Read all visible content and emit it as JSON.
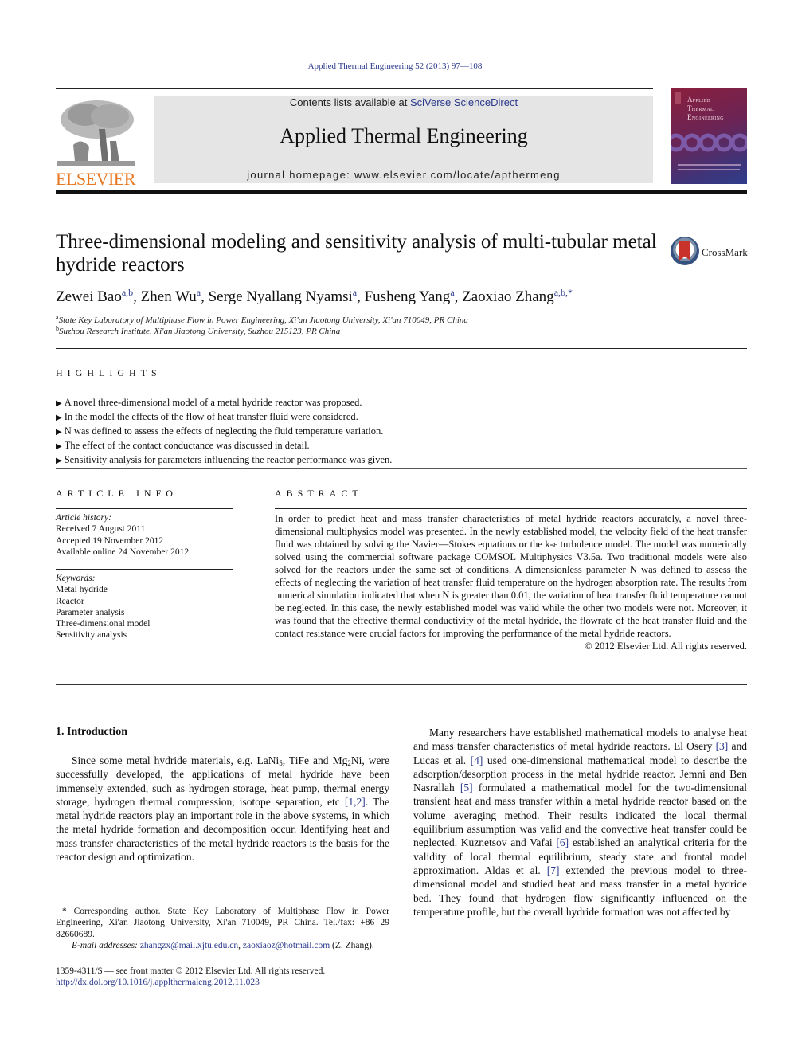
{
  "header": {
    "journal_reference": "Applied Thermal Engineering 52 (2013) 97—108",
    "publisher_logo_text": "ELSEVIER",
    "contents_prefix": "Contents lists available at ",
    "contents_link": "SciVerse ScienceDirect",
    "journal_title": "Applied Thermal Engineering",
    "homepage_prefix": "journal homepage: ",
    "homepage_url": "www.elsevier.com/locate/apthermeng",
    "cover_title_lines": [
      "Applied",
      "Thermal",
      "Engineering"
    ],
    "brand_color": "#e87722",
    "link_color": "#2b3a8c"
  },
  "article": {
    "title": "Three-dimensional modeling and sensitivity analysis of multi-tubular metal hydride reactors",
    "crossmark_label": "CrossMark",
    "authors": [
      {
        "name": "Zewei Bao",
        "affil": "a,b"
      },
      {
        "name": "Zhen Wu",
        "affil": "a"
      },
      {
        "name": "Serge Nyallang Nyamsi",
        "affil": "a"
      },
      {
        "name": "Fusheng Yang",
        "affil": "a"
      },
      {
        "name": "Zaoxiao Zhang",
        "affil": "a,b,*"
      }
    ],
    "affiliations": [
      {
        "mark": "a",
        "text": "State Key Laboratory of Multiphase Flow in Power Engineering, Xi'an Jiaotong University, Xi'an 710049, PR China"
      },
      {
        "mark": "b",
        "text": "Suzhou Research Institute, Xi'an Jiaotong University, Suzhou 215123, PR China"
      }
    ]
  },
  "highlights": {
    "heading": "HIGHLIGHTS",
    "items": [
      "A novel three-dimensional model of a metal hydride reactor was proposed.",
      "In the model the effects of the flow of heat transfer fluid were considered.",
      "N was defined to assess the effects of neglecting the fluid temperature variation.",
      "The effect of the contact conductance was discussed in detail.",
      "Sensitivity analysis for parameters influencing the reactor performance was given."
    ]
  },
  "article_info": {
    "heading": "ARTICLE INFO",
    "history_label": "Article history:",
    "history": [
      "Received 7 August 2011",
      "Accepted 19 November 2012",
      "Available online 24 November 2012"
    ],
    "keywords_label": "Keywords:",
    "keywords": [
      "Metal hydride",
      "Reactor",
      "Parameter analysis",
      "Three-dimensional model",
      "Sensitivity analysis"
    ]
  },
  "abstract": {
    "heading": "ABSTRACT",
    "text": "In order to predict heat and mass transfer characteristics of metal hydride reactors accurately, a novel three-dimensional multiphysics model was presented. In the newly established model, the velocity field of the heat transfer fluid was obtained by solving the Navier—Stokes equations or the k-ε turbulence model. The model was numerically solved using the commercial software package COMSOL Multiphysics V3.5a. Two traditional models were also solved for the reactors under the same set of conditions. A dimensionless parameter N was defined to assess the effects of neglecting the variation of heat transfer fluid temperature on the hydrogen absorption rate. The results from numerical simulation indicated that when N is greater than 0.01, the variation of heat transfer fluid temperature cannot be neglected. In this case, the newly established model was valid while the other two models were not. Moreover, it was found that the effective thermal conductivity of the metal hydride, the flowrate of the heat transfer fluid and the contact resistance were crucial factors for improving the performance of the metal hydride reactors.",
    "copyright": "© 2012 Elsevier Ltd. All rights reserved."
  },
  "introduction": {
    "heading": "1.  Introduction",
    "p1": {
      "a": "Since some metal hydride materials, e.g. LaNi",
      "sub1": "5",
      "b": ", TiFe and Mg",
      "sub2": "2",
      "c": "Ni, were successfully developed, the applications of metal hydride have been immensely extended, such as hydrogen storage, heat pump, thermal energy storage, hydrogen thermal compression, isotope separation, etc ",
      "ref": "[1,2]",
      "d": ". The metal hydride reactors play an important role in the above systems, in which the metal hydride formation and decomposition occur. Identifying heat and mass transfer characteristics of the metal hydride reactors is the basis for the reactor design and optimization."
    },
    "p2": [
      {
        "t": "Many researchers have established mathematical models to analyse heat and mass transfer characteristics of metal hydride reactors. El Osery "
      },
      {
        "ref": "[3]"
      },
      {
        "t": " and Lucas et al. "
      },
      {
        "ref": "[4]"
      },
      {
        "t": " used one-dimensional mathematical model to describe the adsorption/desorption process in the metal hydride reactor. Jemni and Ben Nasrallah "
      },
      {
        "ref": "[5]"
      },
      {
        "t": " formulated a mathematical model for the two-dimensional transient heat and mass transfer within a metal hydride reactor based on the volume averaging method. Their results indicated the local thermal equilibrium assumption was valid and the convective heat transfer could be neglected. Kuznetsov and Vafai "
      },
      {
        "ref": "[6]"
      },
      {
        "t": " established an analytical criteria for the validity of local thermal equilibrium, steady state and frontal model approximation. Aldas et al. "
      },
      {
        "ref": "[7]"
      },
      {
        "t": " extended the previous model to three-dimensional model and studied heat and mass transfer in a metal hydride bed. They found that hydrogen flow significantly influenced on the temperature profile, but the overall hydride formation was not affected by"
      }
    ]
  },
  "footnotes": {
    "corresponding": "* Corresponding author. State Key Laboratory of Multiphase Flow in Power Engineering, Xi'an Jiaotong University, Xi'an 710049, PR China. Tel./fax: +86 29 82660689.",
    "email_label": "E-mail addresses:",
    "emails": [
      "zhangzx@mail.xjtu.edu.cn",
      "zaoxiaoz@hotmail.com"
    ],
    "email_sep": ", ",
    "email_owner": " (Z. Zhang).",
    "front_matter": "1359-4311/$ — see front matter © 2012 Elsevier Ltd. All rights reserved.",
    "doi": "http://dx.doi.org/10.1016/j.applthermaleng.2012.11.023"
  }
}
